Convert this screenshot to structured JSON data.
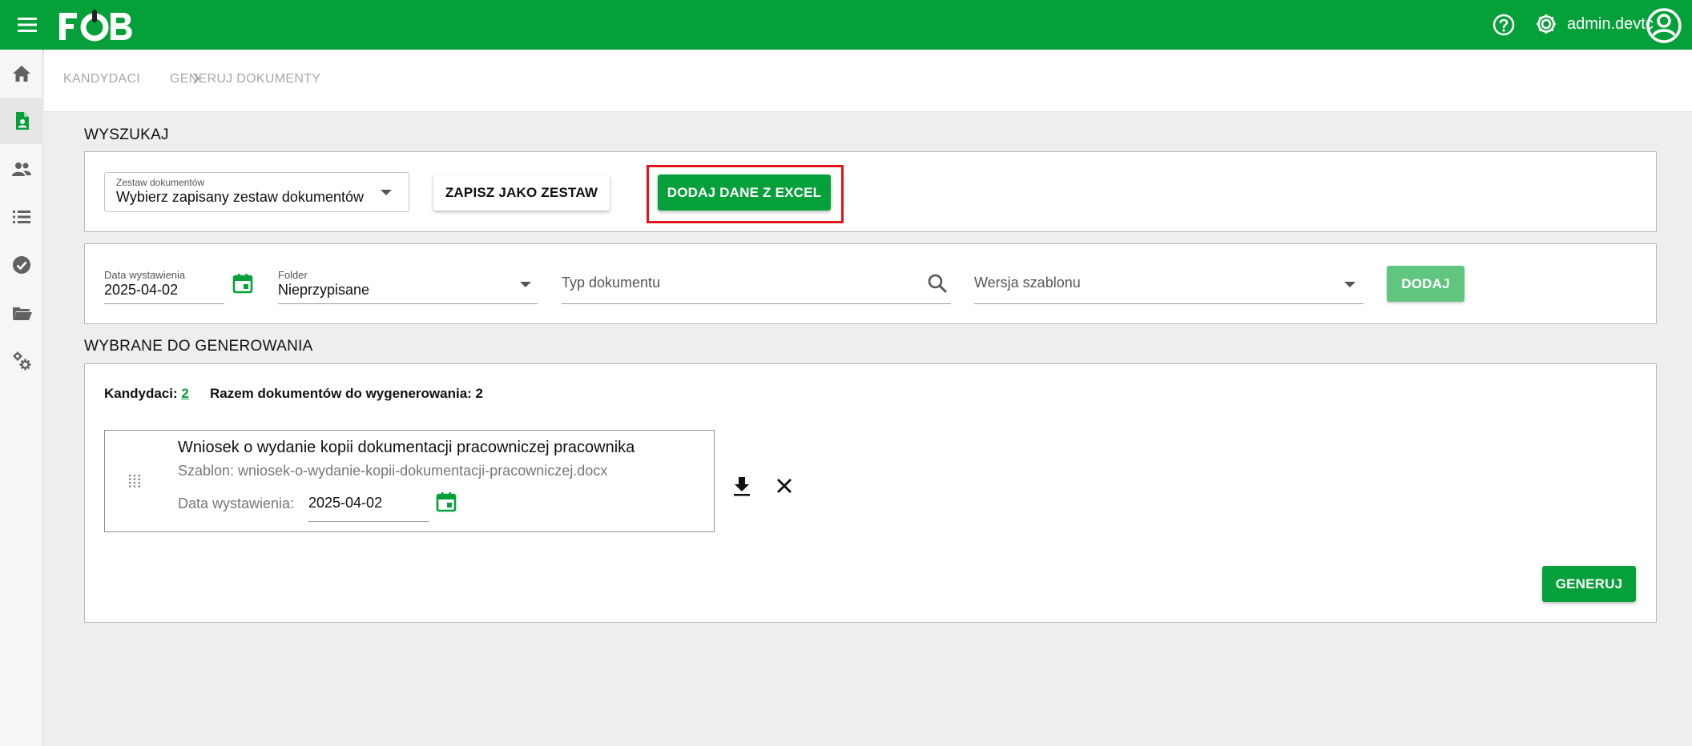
{
  "app": {
    "logo_text": "FOB",
    "username": "admin.devtc",
    "brand_color": "#06a03a",
    "highlight_color": "#e1141b"
  },
  "breadcrumb": {
    "items": [
      "KANDYDACI",
      "GENERUJ DOKUMENTY"
    ]
  },
  "sidebar": {
    "items": [
      {
        "icon": "home-icon"
      },
      {
        "icon": "document-person-icon",
        "active": true
      },
      {
        "icon": "people-icon"
      },
      {
        "icon": "list-icon"
      },
      {
        "icon": "check-circle-icon"
      },
      {
        "icon": "folder-open-icon"
      },
      {
        "icon": "settings-cogs-icon"
      }
    ]
  },
  "search": {
    "title": "WYSZUKAJ",
    "set_select": {
      "label": "Zestaw dokumentów",
      "value": "Wybierz zapisany zestaw dokumentów"
    },
    "save_set_label": "ZAPISZ JAKO ZESTAW",
    "add_excel_label": "DODAJ DANE Z EXCEL"
  },
  "filters": {
    "issue_date": {
      "label": "Data wystawienia",
      "value": "2025-04-02"
    },
    "folder": {
      "label": "Folder",
      "value": "Nieprzypisane"
    },
    "doc_type": {
      "placeholder": "Typ dokumentu"
    },
    "template_version": {
      "placeholder": "Wersja szablonu"
    },
    "add_label": "DODAJ"
  },
  "selected": {
    "title": "WYBRANE DO GENEROWANIA",
    "candidates_label": "Kandydaci:",
    "candidates_count": "2",
    "total_label": "Razem dokumentów do wygenerowania: 2",
    "documents": [
      {
        "title": "Wniosek o wydanie kopii dokumentacji pracowniczej pracownika",
        "template": "Szablon: wniosek-o-wydanie-kopii-dokumentacji-pracowniczej.docx",
        "date_label": "Data wystawienia:",
        "date_value": "2025-04-02"
      }
    ],
    "generate_label": "GENERUJ"
  }
}
